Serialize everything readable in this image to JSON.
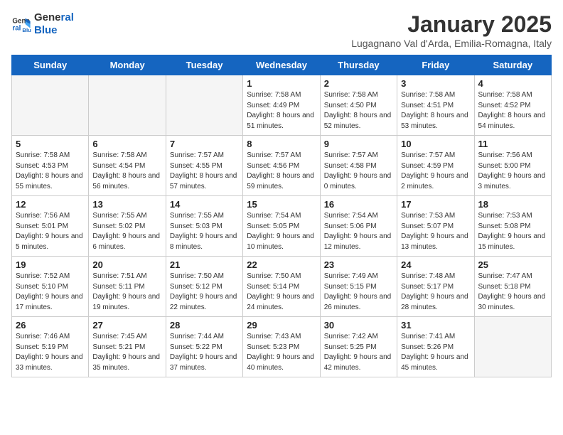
{
  "logo": {
    "line1": "General",
    "line2": "Blue"
  },
  "title": "January 2025",
  "subtitle": "Lugagnano Val d'Arda, Emilia-Romagna, Italy",
  "days_of_week": [
    "Sunday",
    "Monday",
    "Tuesday",
    "Wednesday",
    "Thursday",
    "Friday",
    "Saturday"
  ],
  "weeks": [
    [
      {
        "day": "",
        "empty": true
      },
      {
        "day": "",
        "empty": true
      },
      {
        "day": "",
        "empty": true
      },
      {
        "day": "1",
        "sunrise": "7:58 AM",
        "sunset": "4:49 PM",
        "daylight": "8 hours and 51 minutes."
      },
      {
        "day": "2",
        "sunrise": "7:58 AM",
        "sunset": "4:50 PM",
        "daylight": "8 hours and 52 minutes."
      },
      {
        "day": "3",
        "sunrise": "7:58 AM",
        "sunset": "4:51 PM",
        "daylight": "8 hours and 53 minutes."
      },
      {
        "day": "4",
        "sunrise": "7:58 AM",
        "sunset": "4:52 PM",
        "daylight": "8 hours and 54 minutes."
      }
    ],
    [
      {
        "day": "5",
        "sunrise": "7:58 AM",
        "sunset": "4:53 PM",
        "daylight": "8 hours and 55 minutes."
      },
      {
        "day": "6",
        "sunrise": "7:58 AM",
        "sunset": "4:54 PM",
        "daylight": "8 hours and 56 minutes."
      },
      {
        "day": "7",
        "sunrise": "7:57 AM",
        "sunset": "4:55 PM",
        "daylight": "8 hours and 57 minutes."
      },
      {
        "day": "8",
        "sunrise": "7:57 AM",
        "sunset": "4:56 PM",
        "daylight": "8 hours and 59 minutes."
      },
      {
        "day": "9",
        "sunrise": "7:57 AM",
        "sunset": "4:58 PM",
        "daylight": "9 hours and 0 minutes."
      },
      {
        "day": "10",
        "sunrise": "7:57 AM",
        "sunset": "4:59 PM",
        "daylight": "9 hours and 2 minutes."
      },
      {
        "day": "11",
        "sunrise": "7:56 AM",
        "sunset": "5:00 PM",
        "daylight": "9 hours and 3 minutes."
      }
    ],
    [
      {
        "day": "12",
        "sunrise": "7:56 AM",
        "sunset": "5:01 PM",
        "daylight": "9 hours and 5 minutes."
      },
      {
        "day": "13",
        "sunrise": "7:55 AM",
        "sunset": "5:02 PM",
        "daylight": "9 hours and 6 minutes."
      },
      {
        "day": "14",
        "sunrise": "7:55 AM",
        "sunset": "5:03 PM",
        "daylight": "9 hours and 8 minutes."
      },
      {
        "day": "15",
        "sunrise": "7:54 AM",
        "sunset": "5:05 PM",
        "daylight": "9 hours and 10 minutes."
      },
      {
        "day": "16",
        "sunrise": "7:54 AM",
        "sunset": "5:06 PM",
        "daylight": "9 hours and 12 minutes."
      },
      {
        "day": "17",
        "sunrise": "7:53 AM",
        "sunset": "5:07 PM",
        "daylight": "9 hours and 13 minutes."
      },
      {
        "day": "18",
        "sunrise": "7:53 AM",
        "sunset": "5:08 PM",
        "daylight": "9 hours and 15 minutes."
      }
    ],
    [
      {
        "day": "19",
        "sunrise": "7:52 AM",
        "sunset": "5:10 PM",
        "daylight": "9 hours and 17 minutes."
      },
      {
        "day": "20",
        "sunrise": "7:51 AM",
        "sunset": "5:11 PM",
        "daylight": "9 hours and 19 minutes."
      },
      {
        "day": "21",
        "sunrise": "7:50 AM",
        "sunset": "5:12 PM",
        "daylight": "9 hours and 22 minutes."
      },
      {
        "day": "22",
        "sunrise": "7:50 AM",
        "sunset": "5:14 PM",
        "daylight": "9 hours and 24 minutes."
      },
      {
        "day": "23",
        "sunrise": "7:49 AM",
        "sunset": "5:15 PM",
        "daylight": "9 hours and 26 minutes."
      },
      {
        "day": "24",
        "sunrise": "7:48 AM",
        "sunset": "5:17 PM",
        "daylight": "9 hours and 28 minutes."
      },
      {
        "day": "25",
        "sunrise": "7:47 AM",
        "sunset": "5:18 PM",
        "daylight": "9 hours and 30 minutes."
      }
    ],
    [
      {
        "day": "26",
        "sunrise": "7:46 AM",
        "sunset": "5:19 PM",
        "daylight": "9 hours and 33 minutes."
      },
      {
        "day": "27",
        "sunrise": "7:45 AM",
        "sunset": "5:21 PM",
        "daylight": "9 hours and 35 minutes."
      },
      {
        "day": "28",
        "sunrise": "7:44 AM",
        "sunset": "5:22 PM",
        "daylight": "9 hours and 37 minutes."
      },
      {
        "day": "29",
        "sunrise": "7:43 AM",
        "sunset": "5:23 PM",
        "daylight": "9 hours and 40 minutes."
      },
      {
        "day": "30",
        "sunrise": "7:42 AM",
        "sunset": "5:25 PM",
        "daylight": "9 hours and 42 minutes."
      },
      {
        "day": "31",
        "sunrise": "7:41 AM",
        "sunset": "5:26 PM",
        "daylight": "9 hours and 45 minutes."
      },
      {
        "day": "",
        "empty": true
      }
    ]
  ]
}
